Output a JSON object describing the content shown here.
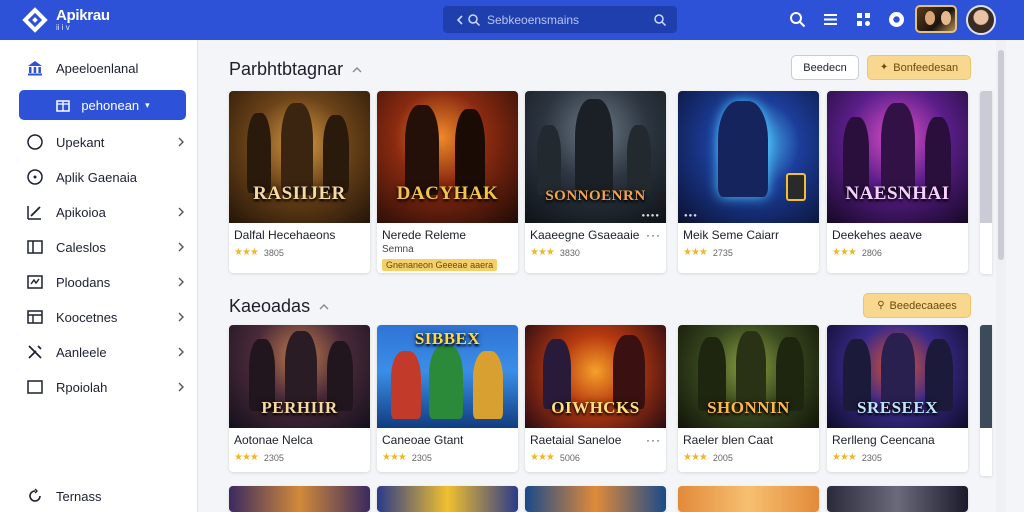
{
  "app": {
    "title": "Apikrau",
    "subtitle": "ii i v"
  },
  "search": {
    "placeholder": "Sebkeoensmains"
  },
  "sidebar": {
    "items": [
      {
        "label": "Apeeloenlanal",
        "icon": "bank-icon",
        "has_chevron": false
      },
      {
        "label": "pehonean",
        "icon": "store-icon",
        "active": true
      },
      {
        "label": "Upekant",
        "icon": "circle-icon",
        "has_chevron": true
      },
      {
        "label": "Aplik Gaenaia",
        "icon": "compass-icon",
        "has_chevron": false
      },
      {
        "label": "Apikoioa",
        "icon": "edit-icon",
        "has_chevron": true
      },
      {
        "label": "Caleslos",
        "icon": "panel-icon",
        "has_chevron": true
      },
      {
        "label": "Ploodans",
        "icon": "chart-icon",
        "has_chevron": true
      },
      {
        "label": "Koocetnes",
        "icon": "layout-icon",
        "has_chevron": true
      },
      {
        "label": "Aanleele",
        "icon": "tools-icon",
        "has_chevron": true
      },
      {
        "label": "Rpoiolah",
        "icon": "square-icon",
        "has_chevron": true
      }
    ],
    "footer": {
      "label": "Ternass",
      "icon": "refresh-icon"
    }
  },
  "section1": {
    "title": "Parbhtbtagnar",
    "button_outline": "Beedecn",
    "button_gold": "Bonfeedesan",
    "cards": [
      {
        "banner": "RASIIJER",
        "name": "Dalfal Hecehaeons",
        "rating": "3805",
        "theme": "gold"
      },
      {
        "banner": "DACYHAK",
        "name": "Nerede Releme",
        "sub": "Semna",
        "tag": "Gnenaneon Geeeae aaera",
        "theme": "fire"
      },
      {
        "banner": "SONNOENRN",
        "name": "Kaaeegne Gsaeaaie",
        "rating": "3830",
        "more": true,
        "theme": "steel"
      },
      {
        "banner": "",
        "name": "Meik Seme Caiarr",
        "rating": "2735",
        "theme": "blue"
      },
      {
        "banner": "NAESNHAI",
        "name": "Deekehes aeave",
        "rating": "2806",
        "theme": "purple"
      }
    ]
  },
  "section2": {
    "title": "Kaeoadas",
    "button_gold": "Beedecaaees",
    "cards": [
      {
        "banner": "PERHIIR",
        "name": "Aotonae Nelca",
        "rating": "2305",
        "theme": "dusk"
      },
      {
        "banner": "SIBBEX",
        "name": "Caneoae Gtant",
        "rating": "2305",
        "theme": "comic"
      },
      {
        "banner": "OIWHCKS",
        "name": "Raetaial Saneloe",
        "rating": "5006",
        "more": true,
        "theme": "flame"
      },
      {
        "banner": "SHONNIN",
        "name": "Raeler blen Caat",
        "rating": "2005",
        "theme": "green"
      },
      {
        "banner": "SRESEEX",
        "name": "Rerlleng Ceencana",
        "rating": "2305",
        "theme": "neon"
      }
    ]
  },
  "colors": {
    "topbar": "#2d52d8",
    "accent_gold": "#f7d88e",
    "star": "#f1b72a"
  }
}
